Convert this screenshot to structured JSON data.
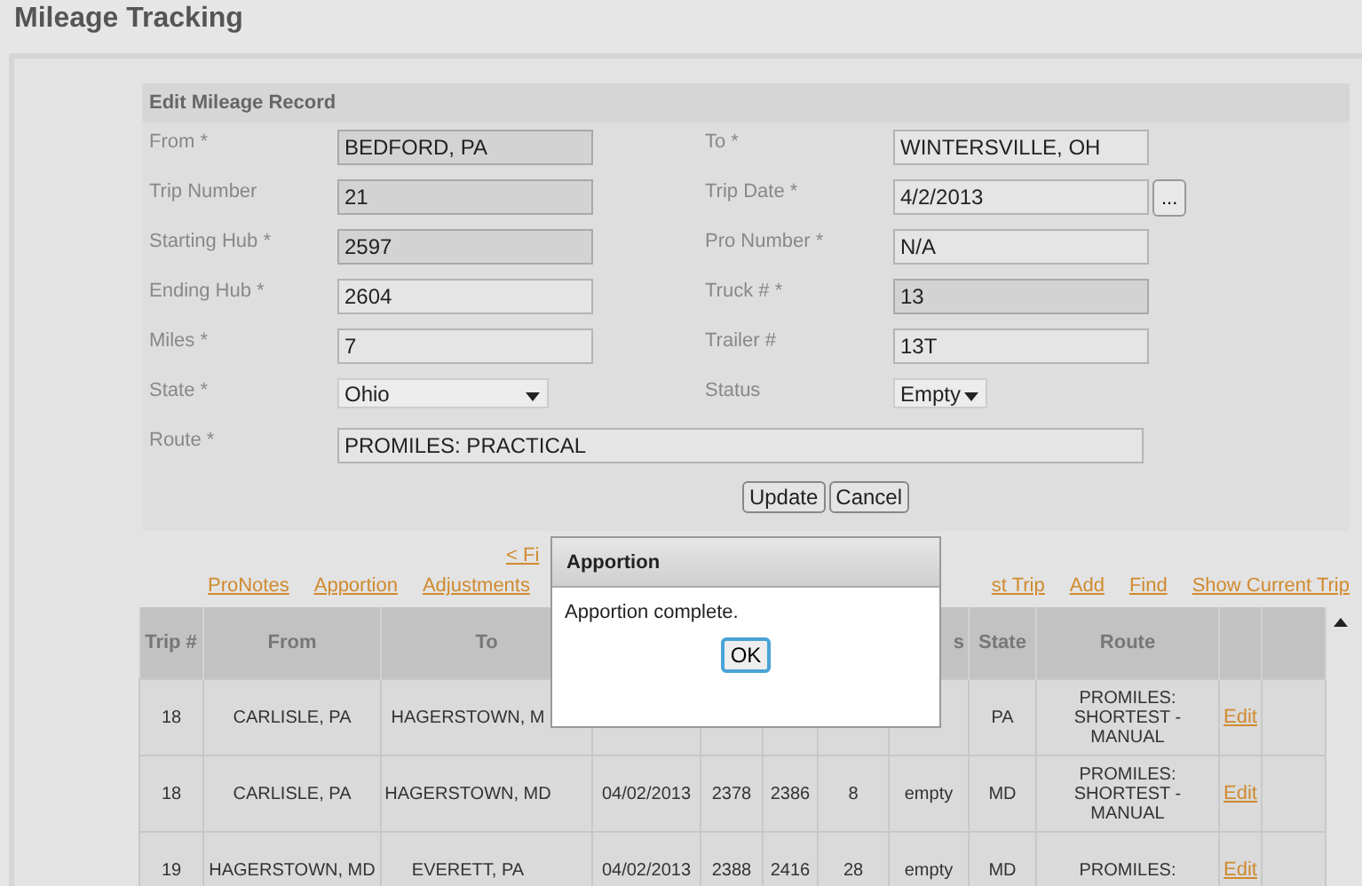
{
  "title": "Mileage Tracking",
  "form": {
    "title": "Edit Mileage Record",
    "fields": [
      {
        "label": "From *",
        "value": "BEDFORD, PA",
        "kind": "text",
        "readonly": true
      },
      {
        "label": "To *",
        "value": "WINTERSVILLE, OH",
        "kind": "text",
        "readonly": false
      },
      {
        "label": "Trip Number",
        "value": "21",
        "kind": "text",
        "readonly": true
      },
      {
        "label": "Trip Date *",
        "value": "4/2/2013",
        "kind": "date",
        "readonly": false,
        "button": "..."
      },
      {
        "label": "Starting Hub *",
        "value": "2597",
        "kind": "text",
        "readonly": true
      },
      {
        "label": "Pro Number *",
        "value": "N/A",
        "kind": "text",
        "readonly": false
      },
      {
        "label": "Ending Hub *",
        "value": "2604",
        "kind": "text",
        "readonly": false
      },
      {
        "label": "Truck # *",
        "value": "13",
        "kind": "text",
        "readonly": true
      },
      {
        "label": "Miles *",
        "value": "7",
        "kind": "text",
        "readonly": false
      },
      {
        "label": "Trailer #",
        "value": "13T",
        "kind": "text",
        "readonly": false
      },
      {
        "label": "State *",
        "value": "Ohio",
        "kind": "select",
        "readonly": false
      },
      {
        "label": "Status",
        "value": "Empty",
        "kind": "small-select",
        "readonly": false
      },
      {
        "label": "Route *",
        "value": "PROMILES: PRACTICAL",
        "kind": "wide",
        "readonly": false
      }
    ],
    "buttons": [
      "Update",
      "Cancel"
    ]
  },
  "pager_link": "< Fi",
  "links_left": [
    "ProNotes",
    "Apportion",
    "Adjustments"
  ],
  "links_right": [
    "st Trip",
    "Add",
    "Find",
    "Show Current Trip"
  ],
  "table": {
    "columns": [
      "Trip #",
      "From",
      "To",
      null,
      null,
      null,
      null,
      "s",
      "State",
      "Route",
      null,
      null
    ],
    "rows": [
      {
        "cells": [
          "18",
          "CARLISLE, PA",
          "HAGERSTOWN, M",
          null,
          null,
          null,
          null,
          null,
          "PA",
          "PROMILES: SHORTEST - MANUAL"
        ],
        "action": "Edit"
      },
      {
        "cells": [
          "18",
          "CARLISLE, PA",
          "HAGERSTOWN, MD",
          "04/02/2013",
          "2378",
          "2386",
          "8",
          "empty",
          "MD",
          "PROMILES: SHORTEST - MANUAL"
        ],
        "action": "Edit"
      },
      {
        "cells": [
          "19",
          "HAGERSTOWN, MD",
          "EVERETT, PA",
          "04/02/2013",
          "2388",
          "2416",
          "28",
          "empty",
          "MD",
          "PROMILES:"
        ],
        "action": "Edit"
      }
    ]
  },
  "dialog": {
    "title": "Apportion",
    "message": "Apportion complete.",
    "button": "OK"
  }
}
